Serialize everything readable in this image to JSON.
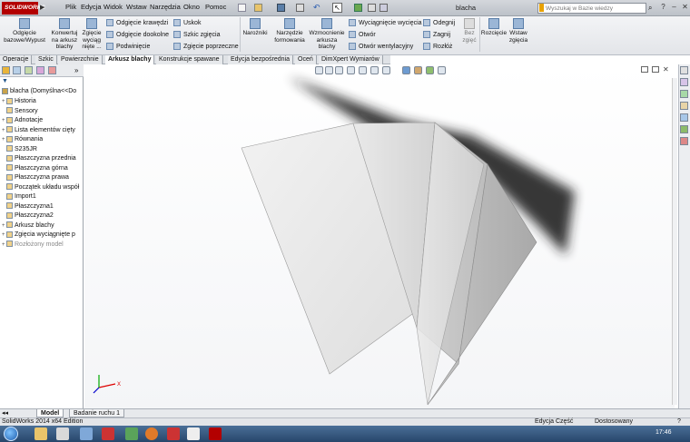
{
  "titlebar": {
    "logo": "SOLIDWORKS",
    "menus": [
      "Plik",
      "Edycja",
      "Widok",
      "Wstaw",
      "Narzędzia",
      "Okno",
      "Pomoc"
    ],
    "document_title": "blacha",
    "search_placeholder": "Wyszukaj w Bazie wiedzy",
    "window_buttons": [
      "?",
      "–",
      "❐",
      "✕"
    ]
  },
  "ribbon": {
    "big_buttons": [
      {
        "label": "Odgięcie\nbazowe/Wypust"
      },
      {
        "label": "Konwertuj\nna arkusz\nblachy"
      },
      {
        "label": "Zgięcie\nwyciąg\nnięte ..."
      }
    ],
    "col1": [
      "Odgięcie krawędzi",
      "Odgięcie dookolne",
      "Podwinięcie"
    ],
    "col2": [
      "Uskok",
      "Szkic zgięcia",
      "Zgięcie poprzeczne"
    ],
    "mid_buttons": [
      {
        "label": "Narożniki"
      },
      {
        "label": "Narzędzie\nformowania"
      },
      {
        "label": "Wzmocnienie\narkusza\nblachy"
      }
    ],
    "col3": [
      "Wyciągnięcie wycięcia",
      "Otwór",
      "Otwór wentylacyjny"
    ],
    "col4": [
      "Odegnij",
      "Zagnij",
      "Rozłóż"
    ],
    "bez_zgiec": "Bez\nzgięć",
    "right_buttons": [
      {
        "label": "Rozcięcie"
      },
      {
        "label": "Wstaw\nzgięcia"
      }
    ]
  },
  "tabs": [
    {
      "label": "Operacje",
      "active": false
    },
    {
      "label": "Szkic",
      "active": false
    },
    {
      "label": "Powierzchnie",
      "active": false
    },
    {
      "label": "Arkusz blachy",
      "active": true
    },
    {
      "label": "Konstrukcje spawane",
      "active": false
    },
    {
      "label": "Edycja bezpośrednia",
      "active": false
    },
    {
      "label": "Oceń",
      "active": false
    },
    {
      "label": "DimXpert Wymiarów",
      "active": false
    }
  ],
  "tree": {
    "filter_icon": "filter-icon",
    "root": "blacha  (Domyślna<<Do",
    "nodes": [
      {
        "label": "Historia",
        "expander": "+"
      },
      {
        "label": "Sensory",
        "expander": ""
      },
      {
        "label": "Adnotacje",
        "expander": "+"
      },
      {
        "label": "Lista elementów cięty",
        "expander": "+"
      },
      {
        "label": "Równania",
        "expander": "+"
      },
      {
        "label": "S235JR",
        "expander": ""
      },
      {
        "label": "Płaszczyzna przednia",
        "expander": ""
      },
      {
        "label": "Płaszczyzna górna",
        "expander": ""
      },
      {
        "label": "Płaszczyzna prawa",
        "expander": ""
      },
      {
        "label": "Początek układu współ",
        "expander": ""
      },
      {
        "label": "Import1",
        "expander": ""
      },
      {
        "label": "Płaszczyzna1",
        "expander": ""
      },
      {
        "label": "Płaszczyzna2",
        "expander": ""
      },
      {
        "label": "Arkusz blachy",
        "expander": "+"
      },
      {
        "label": "Zgięcia wyciągnięte p",
        "expander": "+"
      },
      {
        "label": "Rozłożony model",
        "expander": "+",
        "grey": true
      }
    ]
  },
  "bottom_tabs": [
    {
      "label": "Model",
      "active": true
    },
    {
      "label": "Badanie ruchu 1",
      "active": false
    }
  ],
  "statusbar": {
    "left": "SolidWorks 2014 x64 Edition",
    "mode": "Edycja Część",
    "units": "Dostosowany",
    "help": "?"
  },
  "taskbar": {
    "clock": "17:46"
  },
  "colors": {
    "accent_red": "#b30000",
    "ribbon_bg": "#e9ebee",
    "taskbar": "#27466b",
    "sheet_light": "#e8e8e8",
    "sheet_dark": "#a9a9a9"
  }
}
